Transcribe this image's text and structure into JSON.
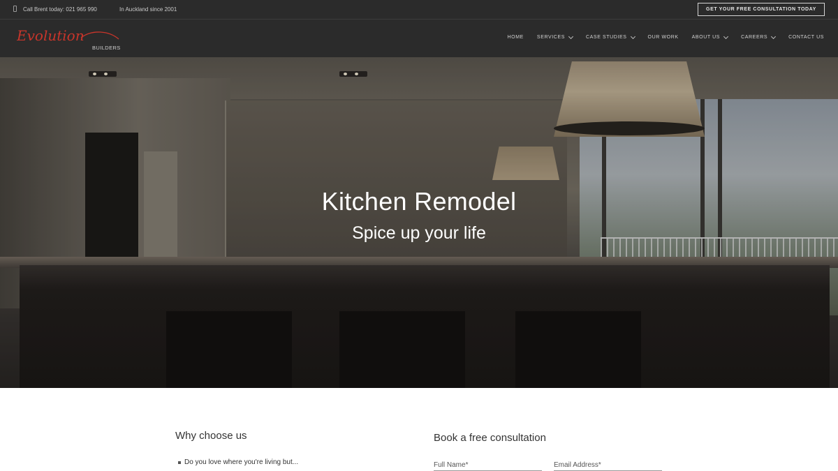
{
  "topbar": {
    "phone_text": "Call Brent today: 021 965 990",
    "since_text": "In Auckland since 2001",
    "cta_label": "GET YOUR FREE CONSULTATION TODAY"
  },
  "header": {
    "logo_script": "Evolution",
    "logo_sub": "BUILDERS",
    "nav": [
      {
        "label": "HOME",
        "dropdown": false
      },
      {
        "label": "SERVICES",
        "dropdown": true
      },
      {
        "label": "CASE STUDIES",
        "dropdown": true
      },
      {
        "label": "OUR WORK",
        "dropdown": false
      },
      {
        "label": "ABOUT US",
        "dropdown": true
      },
      {
        "label": "CAREERS",
        "dropdown": true
      },
      {
        "label": "CONTACT US",
        "dropdown": false
      }
    ]
  },
  "hero": {
    "title": "Kitchen Remodel",
    "subtitle": "Spice up your life"
  },
  "why": {
    "title": "Why choose us",
    "items": [
      "Do you love where you're living but..."
    ]
  },
  "book": {
    "title": "Book a free consultation",
    "full_name_placeholder": "Full Name*",
    "email_placeholder": "Email Address*"
  },
  "colors": {
    "bar_bg": "#2b2b2b",
    "logo_red": "#c8352b",
    "text_dark": "#333333"
  }
}
